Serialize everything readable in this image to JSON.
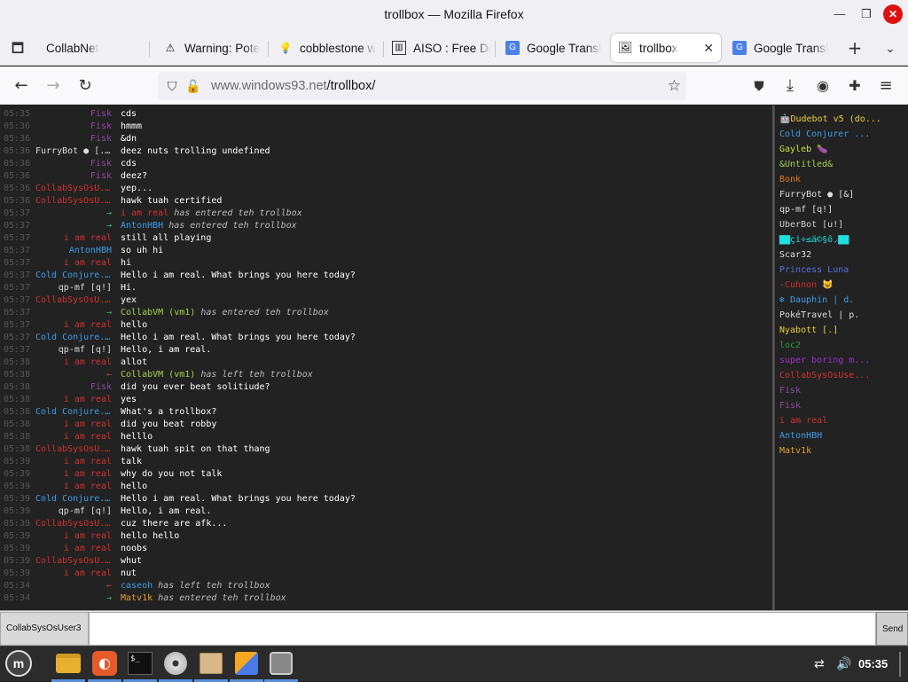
{
  "window": {
    "title": "trollbox — Mozilla Firefox"
  },
  "tabs": [
    {
      "label": "CollabNet",
      "icon": "none"
    },
    {
      "label": "Warning: Pote",
      "icon": "warning-icon"
    },
    {
      "label": "cobblestone w",
      "icon": "lightbulb-icon"
    },
    {
      "label": "AISO : Free Do",
      "icon": "aiso-favicon"
    },
    {
      "label": "Google Transl",
      "icon": "google-translate-favicon"
    },
    {
      "label": "trollbox",
      "icon": "windows93-favicon",
      "active": true
    },
    {
      "label": "Google Transl",
      "icon": "google-translate-favicon"
    }
  ],
  "nav": {
    "url_host": "www.windows93.net",
    "url_path": "/trollbox/"
  },
  "chat": [
    {
      "time": "05:35",
      "nick": "Fisk",
      "color": "#8e4a9e",
      "msg": "cds"
    },
    {
      "time": "05:36",
      "nick": "Fisk",
      "color": "#8e4a9e",
      "msg": "hmmm"
    },
    {
      "time": "05:36",
      "nick": "Fisk",
      "color": "#8e4a9e",
      "msg": "&dn"
    },
    {
      "time": "05:36",
      "nick": "FurryBot ● [...",
      "color": "#dddddd",
      "msg": "deez nuts trolling undefined"
    },
    {
      "time": "05:36",
      "nick": "Fisk",
      "color": "#8e4a9e",
      "msg": "cds"
    },
    {
      "time": "05:36",
      "nick": "Fisk",
      "color": "#8e4a9e",
      "msg": "deez?"
    },
    {
      "time": "05:36",
      "nick": "CollabSysOsU...",
      "color": "#d23030",
      "msg": "yep..."
    },
    {
      "time": "05:36",
      "nick": "CollabSysOsU...",
      "color": "#d23030",
      "msg": "hawk tuah certified"
    },
    {
      "time": "05:37",
      "nick": "→",
      "color": "#35c24a",
      "evt_nick": "i am real",
      "evt_color": "#d23030",
      "evt": "has entered teh trollbox"
    },
    {
      "time": "05:37",
      "nick": "→",
      "color": "#35c24a",
      "evt_nick": "AntonHBH",
      "evt_color": "#3d9ce8",
      "evt": "has entered teh trollbox"
    },
    {
      "time": "05:37",
      "nick": "i am real",
      "color": "#d23030",
      "msg": "still all playing"
    },
    {
      "time": "05:37",
      "nick": "AntonHBH",
      "color": "#3d9ce8",
      "msg": "so uh hi"
    },
    {
      "time": "05:37",
      "nick": "i am real",
      "color": "#d23030",
      "msg": "hi"
    },
    {
      "time": "05:37",
      "nick": "Cold Conjure...",
      "color": "#3d9ce8",
      "msg": "Hello i am real. What brings you here today?"
    },
    {
      "time": "05:37",
      "nick": "qp-mf [q!]",
      "color": "#dddddd",
      "msg": "Hi."
    },
    {
      "time": "05:37",
      "nick": "CollabSysOsU...",
      "color": "#d23030",
      "msg": "yex"
    },
    {
      "time": "05:37",
      "nick": "→",
      "color": "#35c24a",
      "evt_nick": "CollabVM (vm1)",
      "evt_color": "#a8d04a",
      "evt": "has entered teh trollbox"
    },
    {
      "time": "05:37",
      "nick": "i am real",
      "color": "#d23030",
      "msg": "hello"
    },
    {
      "time": "05:37",
      "nick": "Cold Conjure...",
      "color": "#3d9ce8",
      "msg": "Hello i am real. What brings you here today?"
    },
    {
      "time": "05:37",
      "nick": "qp-mf [q!]",
      "color": "#dddddd",
      "msg": "Hello, i am real."
    },
    {
      "time": "05:38",
      "nick": "i am real",
      "color": "#d23030",
      "msg": "allot"
    },
    {
      "time": "05:38",
      "nick": "←",
      "color": "#d23030",
      "evt_nick": "CollabVM (vm1)",
      "evt_color": "#a8d04a",
      "evt": "has left teh trollbox"
    },
    {
      "time": "05:38",
      "nick": "Fisk",
      "color": "#8e4a9e",
      "msg": "did you ever beat solitiude?"
    },
    {
      "time": "05:38",
      "nick": "i am real",
      "color": "#d23030",
      "msg": "yes"
    },
    {
      "time": "05:38",
      "nick": "Cold Conjure...",
      "color": "#3d9ce8",
      "msg": "What's a trollbox?"
    },
    {
      "time": "05:38",
      "nick": "i am real",
      "color": "#d23030",
      "msg": "did you beat robby"
    },
    {
      "time": "05:38",
      "nick": "i am real",
      "color": "#d23030",
      "msg": "helllo"
    },
    {
      "time": "05:38",
      "nick": "CollabSysOsU...",
      "color": "#d23030",
      "msg": "hawk tuah spit on that thang"
    },
    {
      "time": "05:39",
      "nick": "i am real",
      "color": "#d23030",
      "msg": "talk"
    },
    {
      "time": "05:39",
      "nick": "i am real",
      "color": "#d23030",
      "msg": "why do you not talk"
    },
    {
      "time": "05:39",
      "nick": "i am real",
      "color": "#d23030",
      "msg": "hello"
    },
    {
      "time": "05:39",
      "nick": "Cold Conjure...",
      "color": "#3d9ce8",
      "msg": "Hello i am real. What brings you here today?"
    },
    {
      "time": "05:39",
      "nick": "qp-mf [q!]",
      "color": "#dddddd",
      "msg": "Hello, i am real."
    },
    {
      "time": "05:39",
      "nick": "CollabSysOsU...",
      "color": "#d23030",
      "msg": "cuz there are afk..."
    },
    {
      "time": "05:39",
      "nick": "i am real",
      "color": "#d23030",
      "msg": "hello hello"
    },
    {
      "time": "05:39",
      "nick": "i am real",
      "color": "#d23030",
      "msg": "noobs"
    },
    {
      "time": "05:39",
      "nick": "CollabSysOsU...",
      "color": "#d23030",
      "msg": "whut"
    },
    {
      "time": "05:39",
      "nick": "i am real",
      "color": "#d23030",
      "msg": "nut"
    },
    {
      "time": "05:34",
      "nick": "←",
      "color": "#d23030",
      "evt_nick": "caseoh",
      "evt_color": "#3d9ce8",
      "evt": "has left teh trollbox"
    },
    {
      "time": "05:34",
      "nick": "→",
      "color": "#35c24a",
      "evt_nick": "Matv1k",
      "evt_color": "#e0a030",
      "evt": "has entered teh trollbox"
    }
  ],
  "users": [
    {
      "name": "🤖Dudebot v5 (do...",
      "color": "#e8d040"
    },
    {
      "name": "Cold Conjurer ...",
      "color": "#3d9ce8"
    },
    {
      "name": "Gayleb 🍆",
      "color": "#c8e040"
    },
    {
      "name": "&Untitled&",
      "color": "#a8d04a"
    },
    {
      "name": "Bonk",
      "color": "#e07820"
    },
    {
      "name": "FurryBot ● [&]",
      "color": "#dddddd"
    },
    {
      "name": "qp-mf [q!]",
      "color": "#dddddd"
    },
    {
      "name": "UberBot [u!]",
      "color": "#cccccc"
    },
    {
      "name": "▇▇çi÷≤ä©§ô◞▇▇",
      "color": "#20e0e0"
    },
    {
      "name": "Scar32",
      "color": "#dddddd"
    },
    {
      "name": "Princess Luna",
      "color": "#5a70e0"
    },
    {
      "name": "-Cuhnon 😺",
      "color": "#d23030"
    },
    {
      "name": "❄ Dauphin | d.",
      "color": "#3d9ce8"
    },
    {
      "name": "PokéTravel | p.",
      "color": "#dddddd"
    },
    {
      "name": "Nyabott [.]",
      "color": "#e8d040"
    },
    {
      "name": "loc2",
      "color": "#2a9a3a"
    },
    {
      "name": "super boring m...",
      "color": "#a030d0"
    },
    {
      "name": "CollabSysOsUse...",
      "color": "#d23030"
    },
    {
      "name": "Fisk",
      "color": "#8e4a9e"
    },
    {
      "name": "Fisk",
      "color": "#8e4a9e"
    },
    {
      "name": "i am real",
      "color": "#d23030"
    },
    {
      "name": "AntonHBH",
      "color": "#3d9ce8"
    },
    {
      "name": "Matv1k",
      "color": "#e0a030"
    }
  ],
  "input": {
    "nick": "CollabSysOsUser3",
    "value": "",
    "send_label": "Send"
  },
  "taskbar": {
    "clock": "05:35"
  }
}
